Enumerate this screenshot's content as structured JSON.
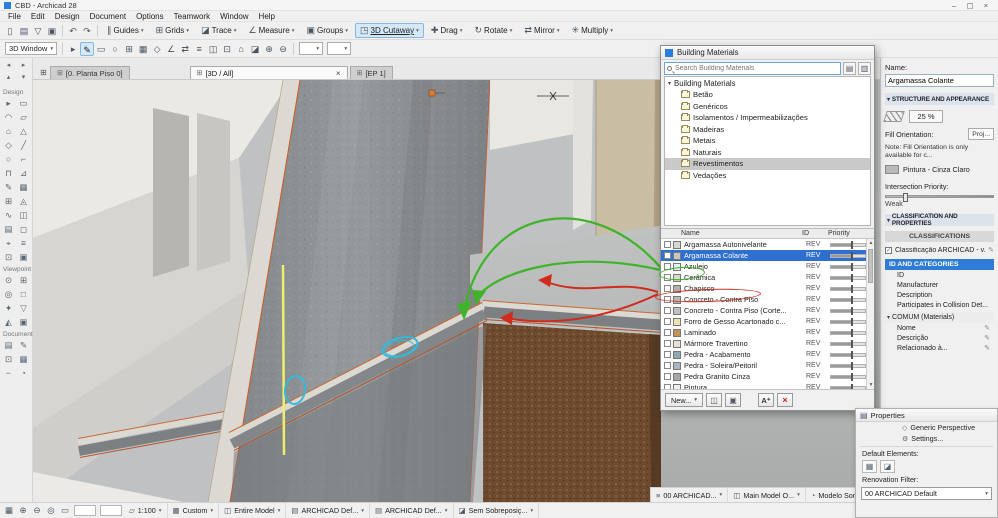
{
  "window": {
    "title": "CBD - Archicad 28"
  },
  "icons": {
    "caret_down": "▾",
    "caret_right": "▸",
    "close": "×",
    "window_min": "–",
    "window_max": "▢",
    "window_close": "×",
    "check": "✓",
    "tab": "⊞",
    "edit": "✎"
  },
  "menu": {
    "items": [
      "File",
      "Edit",
      "Design",
      "Document",
      "Options",
      "Teamwork",
      "Window",
      "Help"
    ]
  },
  "toolbar": {
    "file_icons": [
      "▯",
      "▤",
      "▽",
      "▣"
    ],
    "history_icons": [
      "↶",
      "↷"
    ],
    "buttons": [
      {
        "label": "Guides",
        "icon": "∥"
      },
      {
        "label": "Grids",
        "icon": "⊞"
      },
      {
        "label": "Trace",
        "icon": "◪"
      },
      {
        "label": "Measure",
        "icon": "∠"
      },
      {
        "label": "Groups",
        "icon": "▣"
      },
      {
        "label": "3D Cutaway",
        "icon": "◳",
        "active": true
      },
      {
        "label": "Drag",
        "icon": "✚"
      },
      {
        "label": "Rotate",
        "icon": "↻"
      },
      {
        "label": "Mirror",
        "icon": "⇄"
      },
      {
        "label": "Multiply",
        "icon": "✳"
      }
    ]
  },
  "toolbar2": {
    "view_selector": "3D Window",
    "icons": [
      "▸",
      "✎",
      "▭",
      "○",
      "⊞",
      "▦",
      "◇",
      "∠",
      "⇄",
      "≡",
      "◫",
      "⊡",
      "⌂",
      "◪",
      "⊕",
      "⊖"
    ]
  },
  "toolbox": {
    "nav_icons": [
      "◂",
      "▸",
      "▴",
      "▾"
    ],
    "sections": {
      "design": "Design",
      "viewpoint": "Viewpoint",
      "document": "Document"
    },
    "design_tools": [
      "▸",
      "▭",
      "◠",
      "▱",
      "⌂",
      "△",
      "◇",
      "╱",
      "○",
      "⌐",
      "⊓",
      "⊿",
      "✎",
      "▦",
      "⊞",
      "◬",
      "∿",
      "◫",
      "▤",
      "◻",
      "⌖",
      "≡",
      "⊡",
      "▣"
    ],
    "viewpoint_tools": [
      "⊙",
      "⊞",
      "◎",
      "□",
      "✦",
      "▽",
      "◭",
      "▣"
    ],
    "document_tools": [
      "▤",
      "✎",
      "⊡",
      "▦",
      "−",
      "◔"
    ]
  },
  "viewport": {
    "tabs": [
      {
        "label": "[0. Planta Piso 0]"
      },
      {
        "label": "[3D / All]",
        "active": true,
        "closable": true
      },
      {
        "label": "[EP 1]"
      }
    ]
  },
  "scene": {
    "annotation_colors": {
      "green": "#3fb32a",
      "red": "#d02b1d",
      "cyan": "#35b9da",
      "yellow": "#eded6e"
    }
  },
  "materials_palette": {
    "title": "Building Materials",
    "search_placeholder": "Search Building Materials",
    "tree_root": "Building Materials",
    "tree_items": [
      {
        "label": "Betão"
      },
      {
        "label": "Genéricos"
      },
      {
        "label": "Isolamentos / Impermeabilizações"
      },
      {
        "label": "Madeiras"
      },
      {
        "label": "Metais"
      },
      {
        "label": "Naturais"
      },
      {
        "label": "Revestimentos",
        "selected": true
      },
      {
        "label": "Vedações"
      }
    ],
    "columns": {
      "name": "Name",
      "id": "ID",
      "priority": "Priority"
    },
    "rows": [
      {
        "name": "Argamassa Autonivelante",
        "id": "REV",
        "swatch": "#d8d8d0"
      },
      {
        "name": "Argamassa Colante",
        "id": "REV",
        "swatch": "#c8c8c0",
        "selected": true
      },
      {
        "name": "Azulejo",
        "id": "REV",
        "swatch": "#e8f0f0"
      },
      {
        "name": "Cerâmica",
        "id": "REV",
        "swatch": "#e0d8c8"
      },
      {
        "name": "Chapisco",
        "id": "REV",
        "swatch": "#b0b0a8"
      },
      {
        "name": "Concreto - Contra Piso",
        "id": "REV",
        "swatch": "#b8b8b8"
      },
      {
        "name": "Concreto - Contra Piso (Corte...",
        "id": "REV",
        "swatch": "#c0c0c0"
      },
      {
        "name": "Forro de Gesso Acartonado c...",
        "id": "REV",
        "swatch": "#f0e0b0"
      },
      {
        "name": "Laminado",
        "id": "REV",
        "swatch": "#c89058"
      },
      {
        "name": "Mármore Travertino",
        "id": "REV",
        "swatch": "#e8e0d0"
      },
      {
        "name": "Pedra - Acabamento",
        "id": "REV",
        "swatch": "#90a8b8"
      },
      {
        "name": "Pedra - Soleira/Peitoril",
        "id": "REV",
        "swatch": "#a8b8c0"
      },
      {
        "name": "Pedra Granito Cinza",
        "id": "REV",
        "swatch": "#a8a8a8"
      },
      {
        "name": "Pintura",
        "id": "REV",
        "swatch": "#f0f0f0"
      }
    ],
    "new_button": "New...",
    "button_icons": [
      "◫",
      "▣"
    ],
    "aplus_button": "A⁺"
  },
  "inspector": {
    "name_label": "Name:",
    "name_value": "Argamassa Colante",
    "structure_section": "STRUCTURE AND APPEARANCE",
    "cut_fill_percent": "25 %",
    "fill_orientation_label": "Fill Orientation:",
    "fill_orientation_button": "Proj...",
    "note": "Note: Fill Orientation is only available for c...",
    "surface_value": "Pintura - Cinza Claro",
    "intersection_label": "Intersection Priority:",
    "intersection_value": "Weak",
    "classification_section": "CLASSIFICATION AND PROPERTIES",
    "classifications_header": "CLASSIFICATIONS",
    "classification_item": "Classificação ARCHICAD - v...",
    "id_categories_header": "ID AND CATEGORIES",
    "property_rows": [
      "ID",
      "Manufacturer",
      "Description",
      "Participates in Collision Det..."
    ],
    "comum_header": "COMUM (Materials)",
    "comum_rows": [
      "Nome",
      "Descrição",
      "Relacionado à..."
    ]
  },
  "properties_panel": {
    "title": "Properties",
    "rows": [
      {
        "icon": "◇",
        "label": "Generic Perspective"
      },
      {
        "icon": "⚙",
        "label": "Settings..."
      }
    ],
    "default_elements_label": "Default Elements:",
    "default_element_icons": [
      "▦",
      "◪"
    ],
    "renovation_label": "Renovation Filter:",
    "renovation_value": "00 ARCHICAD Default"
  },
  "statusbar": {
    "left_icons": [
      "▦",
      "⊕",
      "⊖",
      "◎",
      "▭"
    ],
    "segments": [
      {
        "icon": "▱",
        "label": "1:100"
      },
      {
        "icon": "▦",
        "label": "Custom"
      },
      {
        "icon": "◫",
        "label": "Entire Model"
      },
      {
        "icon": "▤",
        "label": "ARCHICAD Def..."
      },
      {
        "icon": "▤",
        "label": "ARCHICAD Def..."
      },
      {
        "icon": "◪",
        "label": "Sem Sobreposiç..."
      }
    ],
    "secondary": [
      {
        "icon": "≡",
        "label": "00 ARCHICAD..."
      },
      {
        "icon": "◫",
        "label": "Main Model O..."
      },
      {
        "icon": "◔",
        "label": "Modelo Somb..."
      }
    ]
  }
}
